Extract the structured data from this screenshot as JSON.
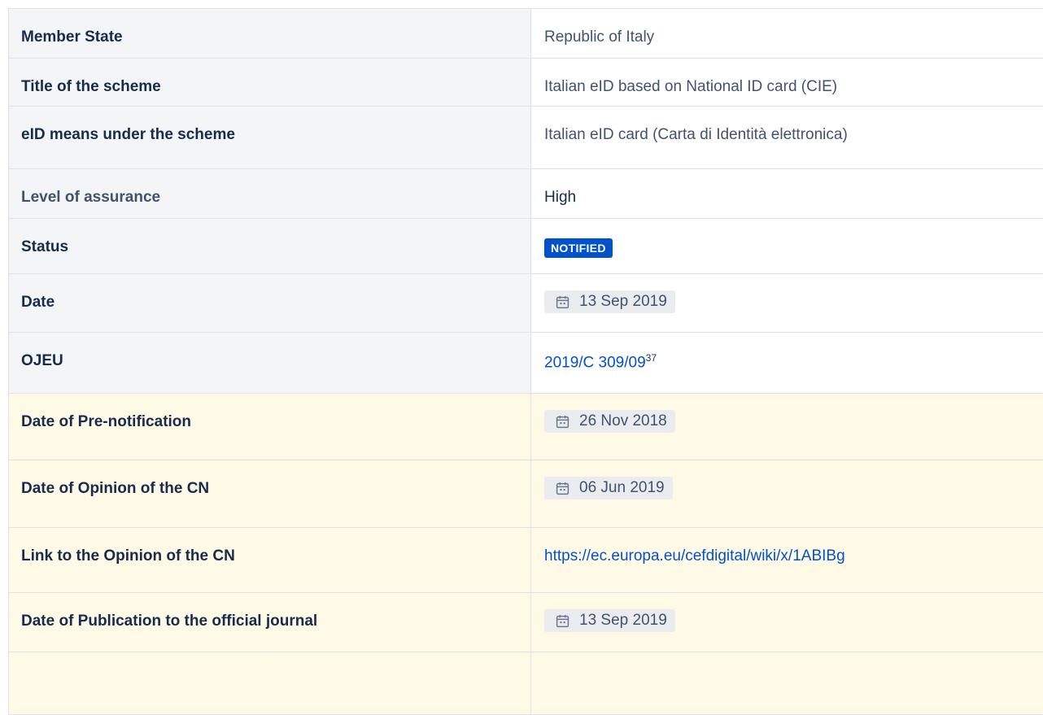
{
  "rows": [
    {
      "label": "Member State",
      "value": "Republic of Italy"
    },
    {
      "label": "Title of the scheme",
      "value": "Italian eID based on National ID card (CIE)"
    },
    {
      "label": "eID means under the scheme",
      "value": "Italian eID card (Carta di Identità elettronica)"
    },
    {
      "label": "Level of assurance",
      "value": "High"
    },
    {
      "label": "Status",
      "badge": "NOTIFIED"
    },
    {
      "label": "Date",
      "date": "13 Sep 2019"
    },
    {
      "label": "OJEU",
      "link": "2019/C 309/09",
      "footnote": "37"
    },
    {
      "label": "Date of Pre-notification",
      "date": "26 Nov 2018"
    },
    {
      "label": "Date of Opinion of the CN",
      "date": "06 Jun 2019"
    },
    {
      "label": "Link to the Opinion of the CN",
      "link": "https://ec.europa.eu/cefdigital/wiki/x/1ABIBg"
    },
    {
      "label": "Date of Publication to the official journal",
      "date": "13 Sep 2019"
    },
    {
      "label": "",
      "value": ""
    }
  ],
  "colors": {
    "label_bg": "#f4f5f7",
    "highlight_bg": "#fffae6",
    "badge_bg": "#0052cc",
    "link": "#0052cc",
    "border": "#dfe1e6"
  },
  "icons": {
    "date": "calendar-icon"
  }
}
